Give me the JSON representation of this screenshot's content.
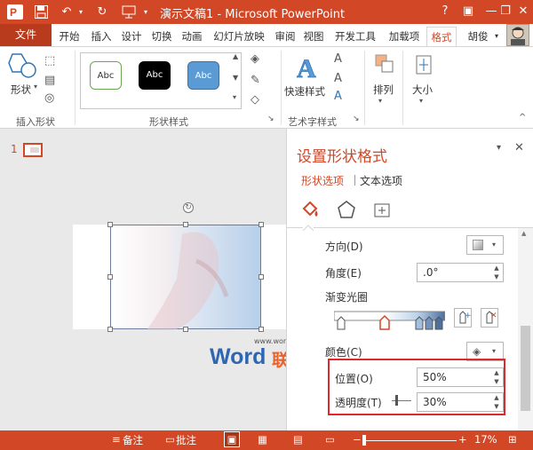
{
  "titlebar": {
    "title": "演示文稿1 - Microsoft PowerPoint",
    "help": "?",
    "minimize": "—",
    "restore": "❐",
    "close": "✕"
  },
  "tabs": {
    "file": "文件",
    "items": [
      "开始",
      "插入",
      "设计",
      "切换",
      "动画",
      "幻灯片放映",
      "审阅",
      "视图",
      "开发工具",
      "加载项",
      "格式"
    ],
    "active": "格式",
    "user": "胡俊"
  },
  "ribbon": {
    "insert_shape": {
      "label": "插入形状",
      "shape_button": "形状"
    },
    "shape_styles": {
      "label": "形状样式",
      "samples": [
        "Abc",
        "Abc",
        "Abc"
      ]
    },
    "art_text": {
      "label": "艺术字样式",
      "quick_styles": "快速样式"
    },
    "arrange": "排列",
    "size": "大小"
  },
  "thumbs": {
    "slide_number": "1"
  },
  "watermark": {
    "url": "www.wordlm.com",
    "brand_w": "Word",
    "brand_cn": "联盟"
  },
  "pane": {
    "title": "设置形状格式",
    "tabs": [
      "形状选项",
      "文本选项"
    ],
    "direction_label": "方向(D)",
    "angle_label": "角度(E)",
    "angle_value": ".0°",
    "gradient_label": "渐变光圈",
    "color_label": "颜色(C)",
    "position_label": "位置(O)",
    "position_value": "50%",
    "transparency_label": "透明度(T)",
    "transparency_value": "30%"
  },
  "status": {
    "notes": "备注",
    "comments": "批注",
    "zoom": "17%"
  },
  "colors": {
    "accent": "#d24726",
    "highlight_box": "#e0272d",
    "ribbon_bg": "#ffffff",
    "stage_bg": "#e9e9e9"
  }
}
